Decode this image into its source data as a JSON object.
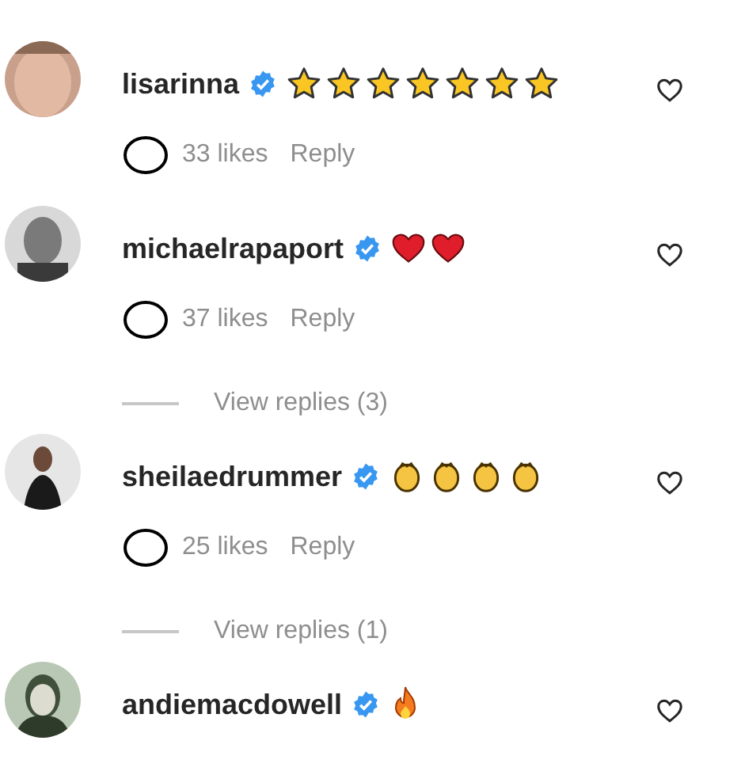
{
  "comments": [
    {
      "username": "lisarinna",
      "verified": true,
      "emoji": [
        {
          "kind": "star"
        },
        {
          "kind": "star"
        },
        {
          "kind": "star"
        },
        {
          "kind": "star"
        },
        {
          "kind": "star"
        },
        {
          "kind": "star"
        },
        {
          "kind": "star"
        }
      ],
      "likes": "33 likes",
      "reply": "Reply",
      "avatar": {
        "kind": "picture"
      }
    },
    {
      "username": "michaelrapaport",
      "verified": true,
      "emoji": [
        {
          "kind": "heart"
        },
        {
          "kind": "heart"
        }
      ],
      "likes": "37 likes",
      "reply": "Reply",
      "view_replies": "View replies (3)",
      "avatar": {
        "kind": "picture"
      }
    },
    {
      "username": "sheilaedrummer",
      "verified": true,
      "emoji": [
        {
          "kind": "clap"
        },
        {
          "kind": "clap"
        },
        {
          "kind": "clap"
        },
        {
          "kind": "clap"
        }
      ],
      "likes": "25 likes",
      "reply": "Reply",
      "view_replies": "View replies (1)",
      "avatar": {
        "kind": "picture"
      }
    },
    {
      "username": "andiemacdowell",
      "verified": true,
      "emoji": [
        {
          "kind": "fire"
        }
      ],
      "avatar": {
        "kind": "picture"
      }
    }
  ]
}
